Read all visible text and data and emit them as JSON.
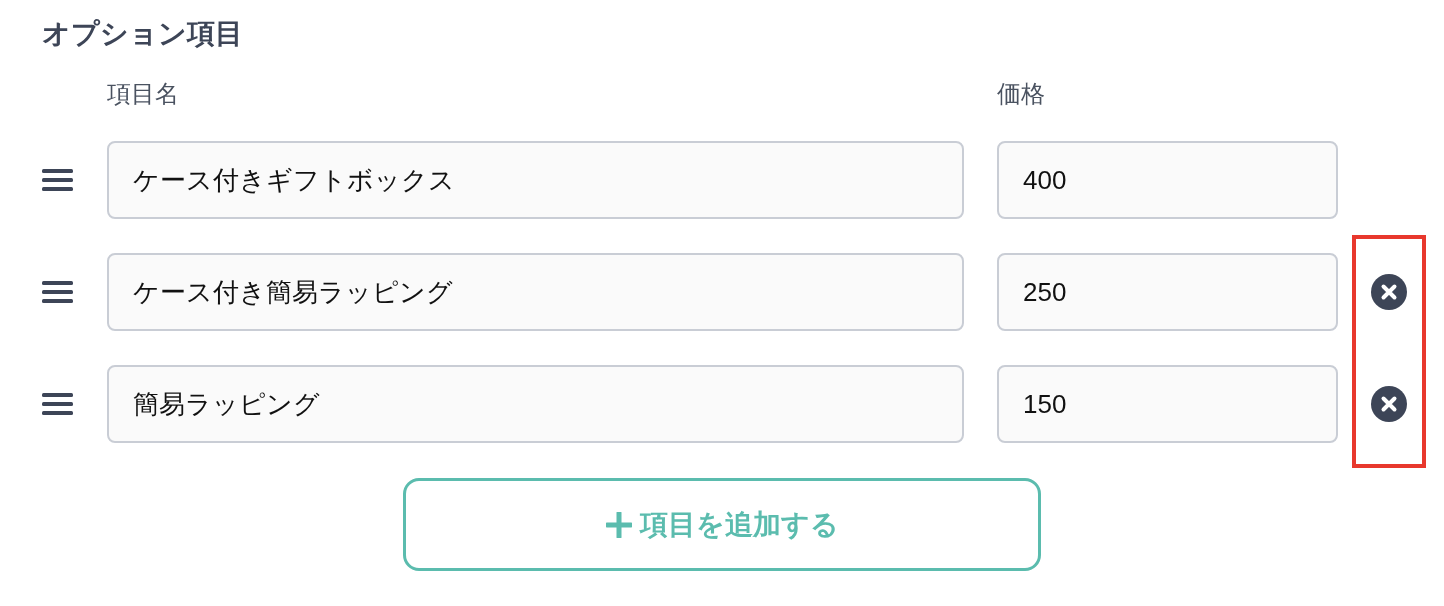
{
  "section": {
    "title": "オプション項目"
  },
  "columns": {
    "name": "項目名",
    "price": "価格"
  },
  "items": [
    {
      "name": "ケース付きギフトボックス",
      "price": "400",
      "removable": false
    },
    {
      "name": "ケース付き簡易ラッピング",
      "price": "250",
      "removable": true
    },
    {
      "name": "簡易ラッピング",
      "price": "150",
      "removable": true
    }
  ],
  "add_button": {
    "label": "項目を追加する"
  },
  "annotation": {
    "kind": "frame"
  }
}
